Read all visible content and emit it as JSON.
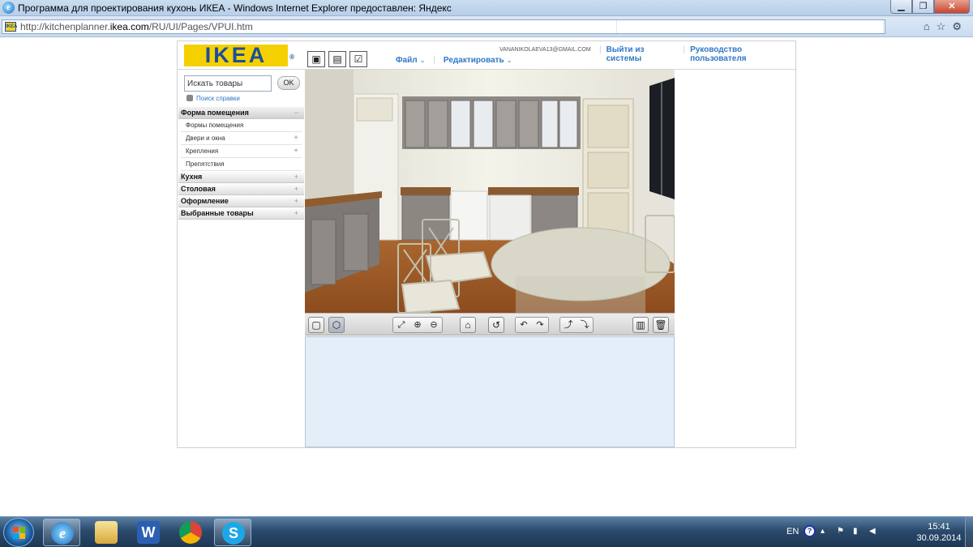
{
  "window": {
    "title": "Программа для проектирования кухонь ИКЕА - Windows Internet Explorer предоставлен: Яндекс",
    "ie_icon": "e"
  },
  "address": {
    "url_prefix": "http://kitchenplanner.",
    "url_host": "ikea.com",
    "url_suffix": "/RU/UI/Pages/VPUI.htm"
  },
  "header": {
    "logo": "IKEA",
    "logo_mark": "®",
    "menu": [
      {
        "label": "Файл"
      },
      {
        "label": "Редактировать"
      }
    ],
    "user_email": "VANANIKOLAEVA13@GMAIL.COM",
    "logout": "Выйти из системы",
    "guide": "Руководство пользователя",
    "icons": [
      "save-icon",
      "print-icon",
      "checklist-icon"
    ]
  },
  "sidebar": {
    "search_placeholder": "Искать товары",
    "ok_label": "OK",
    "help_link": "Поиск справки",
    "sections": [
      {
        "label": "Форма помещения",
        "sign": "−",
        "expanded": true,
        "items": [
          {
            "label": "Формы помещения",
            "sign": ""
          },
          {
            "label": "Двери и окна",
            "sign": "+"
          },
          {
            "label": "Крепления",
            "sign": "+"
          },
          {
            "label": "Препятствия",
            "sign": ""
          }
        ]
      },
      {
        "label": "Кухня",
        "sign": "+"
      },
      {
        "label": "Столовая",
        "sign": "+"
      },
      {
        "label": "Оформление",
        "sign": "+"
      },
      {
        "label": "Выбранные товары",
        "sign": "+"
      }
    ]
  },
  "view_toolbar": {
    "buttons": [
      "2d-view-icon",
      "3d-view-icon",
      "zoom-fit-icon",
      "zoom-in-icon",
      "zoom-out-icon",
      "home-icon",
      "reset-rotate-icon",
      "rotate-left-icon",
      "rotate-right-icon",
      "tilt-up-icon",
      "tilt-down-icon",
      "catalog-icon",
      "trash-icon"
    ],
    "active": "3d-view-icon"
  },
  "taskbar": {
    "apps": [
      "internet-explorer",
      "file-explorer",
      "word",
      "chrome",
      "skype"
    ],
    "active": "internet-explorer",
    "lang": "EN",
    "help": "?",
    "time": "15:41",
    "date": "30.09.2014"
  },
  "colors": {
    "ikea_blue": "#1a4f9c",
    "ikea_yellow": "#f5d000",
    "link_blue": "#2f78c4",
    "catalog_bg": "#e3eef9"
  }
}
